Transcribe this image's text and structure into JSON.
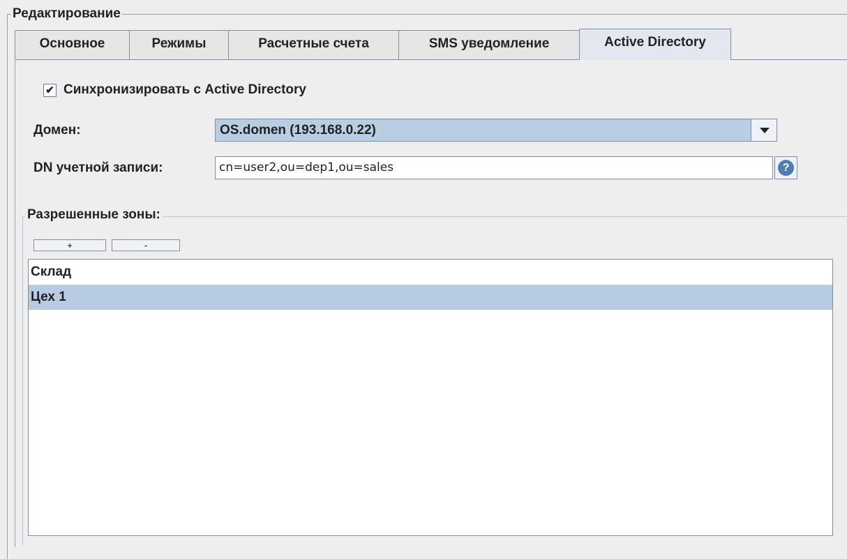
{
  "group_title": "Редактирование",
  "tabs": [
    {
      "label": "Основное",
      "active": false
    },
    {
      "label": "Режимы",
      "active": false
    },
    {
      "label": "Расчетные счета",
      "active": false
    },
    {
      "label": "SMS уведомление",
      "active": false
    },
    {
      "label": "Active Directory",
      "active": true
    }
  ],
  "sync": {
    "label": "Синхронизировать с Active Directory",
    "checked": true,
    "check_glyph": "✔"
  },
  "domain": {
    "label": "Домен:",
    "value": "OS.domen (193.168.0.22)"
  },
  "dn": {
    "label": "DN учетной записи:",
    "value": "cn=user2,ou=dep1,ou=sales",
    "help_glyph": "?"
  },
  "zones": {
    "title": "Разрешенные зоны:",
    "add_label": "+",
    "remove_label": "-",
    "items": [
      {
        "label": "Склад",
        "selected": false
      },
      {
        "label": "Цех 1",
        "selected": true
      }
    ]
  },
  "colors": {
    "selection": "#b7cbe3",
    "combo_bg": "#b9cde3",
    "help_icon": "#4f7cb2"
  }
}
